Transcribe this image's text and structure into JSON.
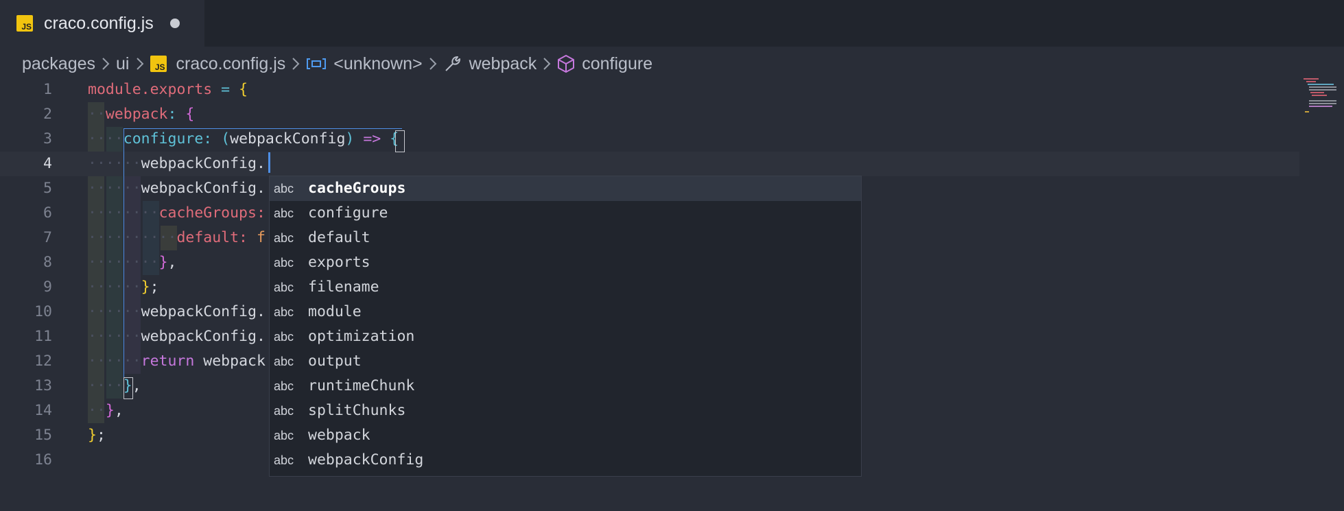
{
  "tab": {
    "title": "craco.config.js",
    "icon_text": "JS",
    "modified": true
  },
  "breadcrumb": {
    "items": [
      {
        "label": "packages",
        "icon": ""
      },
      {
        "label": "ui",
        "icon": ""
      },
      {
        "label": "craco.config.js",
        "icon": "js-file-icon"
      },
      {
        "label": "<unknown>",
        "icon": "symbol-variable-icon"
      },
      {
        "label": "webpack",
        "icon": "wrench-icon"
      },
      {
        "label": "configure",
        "icon": "cube-icon"
      }
    ]
  },
  "editor": {
    "current_line": 4,
    "line_numbers": [
      "1",
      "2",
      "3",
      "4",
      "5",
      "6",
      "7",
      "8",
      "9",
      "10",
      "11",
      "12",
      "13",
      "14",
      "15",
      "16"
    ],
    "lines": [
      [
        {
          "t": "module.exports",
          "c": "k-red"
        },
        {
          "t": " ",
          "c": "k-plain"
        },
        {
          "t": "=",
          "c": "k-cyan"
        },
        {
          "t": " ",
          "c": "k-plain"
        },
        {
          "t": "{",
          "c": "k-gold"
        }
      ],
      [
        {
          "t": "··",
          "c": "dots"
        },
        {
          "t": "webpack",
          "c": "k-red"
        },
        {
          "t": ":",
          "c": "k-cyan"
        },
        {
          "t": " ",
          "c": "k-plain"
        },
        {
          "t": "{",
          "c": "k-mag"
        }
      ],
      [
        {
          "t": "····",
          "c": "dots"
        },
        {
          "t": "configure",
          "c": "k-cyan"
        },
        {
          "t": ":",
          "c": "k-cyan"
        },
        {
          "t": " ",
          "c": "k-plain"
        },
        {
          "t": "(",
          "c": "k-cyan"
        },
        {
          "t": "webpackConfig",
          "c": "k-plain"
        },
        {
          "t": ")",
          "c": "k-cyan"
        },
        {
          "t": " ",
          "c": "k-plain"
        },
        {
          "t": "=>",
          "c": "k-pink"
        },
        {
          "t": " ",
          "c": "k-plain"
        },
        {
          "t": "{",
          "c": "k-cyan"
        }
      ],
      [
        {
          "t": "······",
          "c": "dots"
        },
        {
          "t": "webpackConfig.",
          "c": "k-plain"
        }
      ],
      [
        {
          "t": "······",
          "c": "dots"
        },
        {
          "t": "webpackConfig.",
          "c": "k-plain"
        }
      ],
      [
        {
          "t": "········",
          "c": "dots"
        },
        {
          "t": "cacheGroups:",
          "c": "k-red"
        }
      ],
      [
        {
          "t": "··········",
          "c": "dots"
        },
        {
          "t": "default:",
          "c": "k-red"
        },
        {
          "t": " ",
          "c": "k-plain"
        },
        {
          "t": "f",
          "c": "k-orange"
        }
      ],
      [
        {
          "t": "········",
          "c": "dots"
        },
        {
          "t": "}",
          "c": "k-mag"
        },
        {
          "t": ",",
          "c": "k-plain"
        }
      ],
      [
        {
          "t": "······",
          "c": "dots"
        },
        {
          "t": "}",
          "c": "k-gold"
        },
        {
          "t": ";",
          "c": "k-plain"
        }
      ],
      [
        {
          "t": "······",
          "c": "dots"
        },
        {
          "t": "webpackConfig.",
          "c": "k-plain"
        }
      ],
      [
        {
          "t": "······",
          "c": "dots"
        },
        {
          "t": "webpackConfig.",
          "c": "k-plain"
        }
      ],
      [
        {
          "t": "······",
          "c": "dots"
        },
        {
          "t": "return",
          "c": "k-pink"
        },
        {
          "t": " ",
          "c": "k-plain"
        },
        {
          "t": "webpack",
          "c": "k-plain"
        }
      ],
      [
        {
          "t": "····",
          "c": "dots"
        },
        {
          "t": "}",
          "c": "k-cyan"
        },
        {
          "t": ",",
          "c": "k-plain"
        }
      ],
      [
        {
          "t": "··",
          "c": "dots"
        },
        {
          "t": "}",
          "c": "k-mag"
        },
        {
          "t": ",",
          "c": "k-plain"
        }
      ],
      [
        {
          "t": "}",
          "c": "k-gold"
        },
        {
          "t": ";",
          "c": "k-plain"
        }
      ],
      []
    ]
  },
  "suggestions": {
    "kind_label": "abc",
    "selected_index": 0,
    "items": [
      "cacheGroups",
      "configure",
      "default",
      "exports",
      "filename",
      "module",
      "optimization",
      "output",
      "runtimeChunk",
      "splitChunks",
      "webpack",
      "webpackConfig"
    ]
  },
  "colors": {
    "background": "#292d37",
    "tabbar": "#21252d",
    "cursor": "#4e8fe5",
    "js_badge": "#f1c40f"
  }
}
